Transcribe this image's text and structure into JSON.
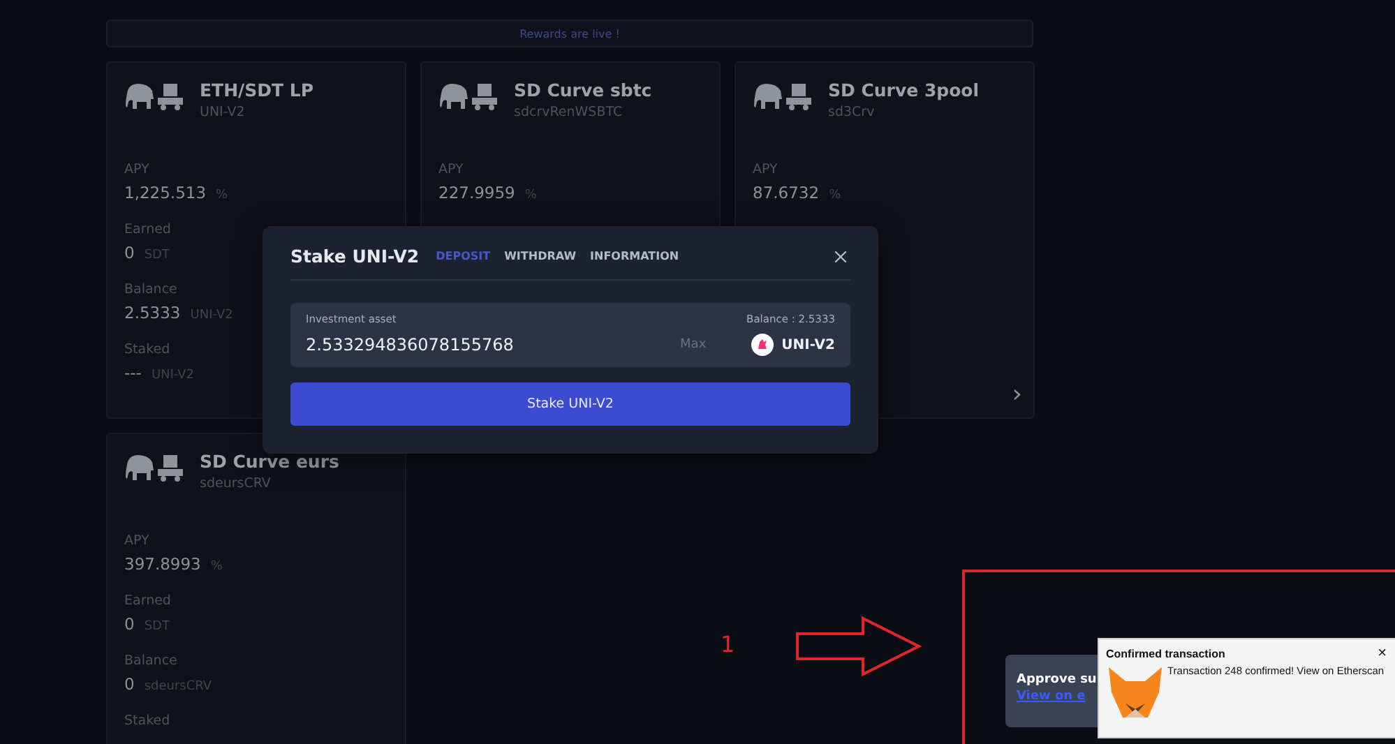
{
  "banner": {
    "text": "Rewards are live !"
  },
  "cards": [
    {
      "name": "ETH/SDT LP",
      "symbol": "UNI-V2",
      "stats": [
        {
          "label": "APY",
          "value": "1,225.513",
          "unit": "%"
        },
        {
          "label": "Earned",
          "value": "0",
          "unit": "SDT"
        },
        {
          "label": "Balance",
          "value": "2.5333",
          "unit": "UNI-V2"
        },
        {
          "label": "Staked",
          "value": "---",
          "unit": "UNI-V2"
        }
      ]
    },
    {
      "name": "SD Curve sbtc",
      "symbol": "sdcrvRenWSBTC",
      "stats": [
        {
          "label": "APY",
          "value": "227.9959",
          "unit": "%"
        }
      ]
    },
    {
      "name": "SD Curve 3pool",
      "symbol": "sd3Crv",
      "next": "›",
      "stats": [
        {
          "label": "APY",
          "value": "87.6732",
          "unit": "%"
        }
      ]
    },
    {
      "name": "SD Curve eurs",
      "symbol": "sdeursCRV",
      "stats": [
        {
          "label": "APY",
          "value": "397.8993",
          "unit": "%"
        },
        {
          "label": "Earned",
          "value": "0",
          "unit": "SDT"
        },
        {
          "label": "Balance",
          "value": "0",
          "unit": "sdeursCRV"
        },
        {
          "label": "Staked"
        }
      ]
    }
  ],
  "modal": {
    "title": "Stake UNI-V2",
    "tabs": [
      {
        "label": "DEPOSIT",
        "selected": true
      },
      {
        "label": "WITHDRAW",
        "selected": false
      },
      {
        "label": "INFORMATION",
        "selected": false
      }
    ],
    "field_label": "Investment asset",
    "balance": "Balance : 2.5333",
    "value": "2.533294836078155768",
    "max": "Max",
    "token": "UNI-V2",
    "button": "Stake UNI-V2"
  },
  "annotation": {
    "number": "1"
  },
  "toast": {
    "title": "Approve su",
    "link": "View on e"
  },
  "notification": {
    "title": "Confirmed transaction",
    "close": "×",
    "message": "Transaction 248 confirmed! View on Etherscan"
  }
}
